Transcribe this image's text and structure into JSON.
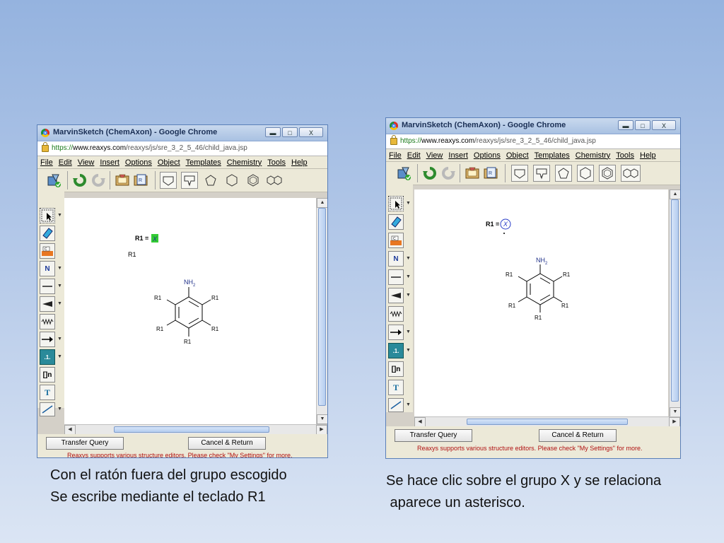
{
  "windows": [
    {
      "title": "MarvinSketch (ChemAxon) - Google Chrome",
      "url_scheme": "https://",
      "url_host": "www.reaxys.com",
      "url_path": "/reaxys/js/sre_3_2_5_46/child_java.jsp",
      "buttons": {
        "transfer": "Transfer Query",
        "cancel": "Cancel & Return"
      },
      "notice": "Reaxys supports various structure editors. Please check \"My Settings\" for more.",
      "canvas": {
        "rgroup_def_label": "R1 =",
        "rgroup_atom": "X",
        "free_label": "R1",
        "substituent": "NH",
        "substituent_sub": "2",
        "ring_labels": [
          "R1",
          "R1",
          "R1",
          "R1",
          "R1"
        ]
      }
    },
    {
      "title": "MarvinSketch (ChemAxon) - Google Chrome",
      "url_scheme": "https://",
      "url_host": "www.reaxys.com",
      "url_path": "/reaxys/js/sre_3_2_5_46/child_java.jsp",
      "buttons": {
        "transfer": "Transfer Query",
        "cancel": "Cancel & Return"
      },
      "notice": "Reaxys supports various structure editors. Please check \"My Settings\" for more.",
      "canvas": {
        "rgroup_def_label": "R1 =",
        "rgroup_atom": "X",
        "substituent": "NH",
        "substituent_sub": "2",
        "ring_labels": [
          "R1",
          "R1",
          "R1",
          "R1",
          "R1"
        ]
      }
    }
  ],
  "menu": [
    "File",
    "Edit",
    "View",
    "Insert",
    "Options",
    "Object",
    "Templates",
    "Chemistry",
    "Tools",
    "Help"
  ],
  "window_controls": {
    "minimize": "▬",
    "maximize": "□",
    "close": "X"
  },
  "left_tool_labels": {
    "nitrogen": "N",
    "rgroup": ".1.",
    "bracket": "[]n",
    "text": "T"
  },
  "captions": {
    "left_line1": "Con  el ratón  fuera del grupo escogido",
    "left_line2": "Se escribe mediante el teclado R1",
    "right_line1": "Se hace clic sobre el grupo X y se relaciona",
    "right_line2": " aparece un asterisco."
  },
  "icons": [
    "chrome-icon",
    "lock-icon",
    "clean-icon",
    "undo-icon",
    "redo-icon",
    "book-icon",
    "paste-icon",
    "cyclopropane-icon",
    "cyclobutane-icon",
    "cyclopentane-icon",
    "cyclohexane-icon",
    "benzene-icon",
    "naphthalene-icon",
    "select-icon",
    "eraser-icon",
    "periodic-table-icon",
    "single-bond-icon",
    "wedge-bond-icon",
    "wavy-bond-icon",
    "arrow-icon",
    "line-icon"
  ],
  "colors": {
    "highlight": "#33cc33",
    "selection_circle": "#2a3dc8",
    "notice": "#b01010",
    "substituent": "#22338a"
  }
}
